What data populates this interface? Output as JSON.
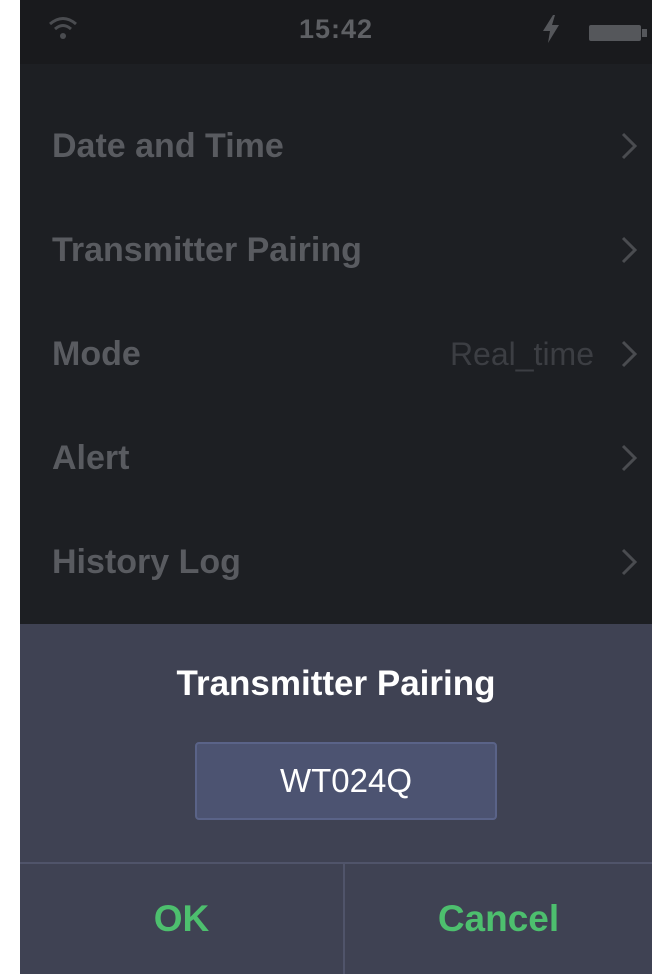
{
  "status_bar": {
    "time": "15:42",
    "icons": [
      "wifi-icon",
      "bolt-icon",
      "battery-icon"
    ]
  },
  "menu": {
    "items": [
      {
        "label": "Date and Time",
        "value": "",
        "icon": "chevron-right-icon"
      },
      {
        "label": "Transmitter Pairing",
        "value": "",
        "icon": "chevron-right-icon"
      },
      {
        "label": "Mode",
        "value": "Real_time",
        "icon": "chevron-right-icon"
      },
      {
        "label": "Alert",
        "value": "",
        "icon": "chevron-right-icon"
      },
      {
        "label": "History Log",
        "value": "",
        "icon": "chevron-right-icon"
      }
    ]
  },
  "dialog": {
    "title": "Transmitter Pairing",
    "input_value": "WT024Q",
    "ok_label": "OK",
    "cancel_label": "Cancel"
  },
  "colors": {
    "background": "#1d1f23",
    "dialog_background": "#3f4253",
    "input_background": "#4c5371",
    "button_text": "#4dbf6e",
    "menu_text": "#595b60"
  }
}
